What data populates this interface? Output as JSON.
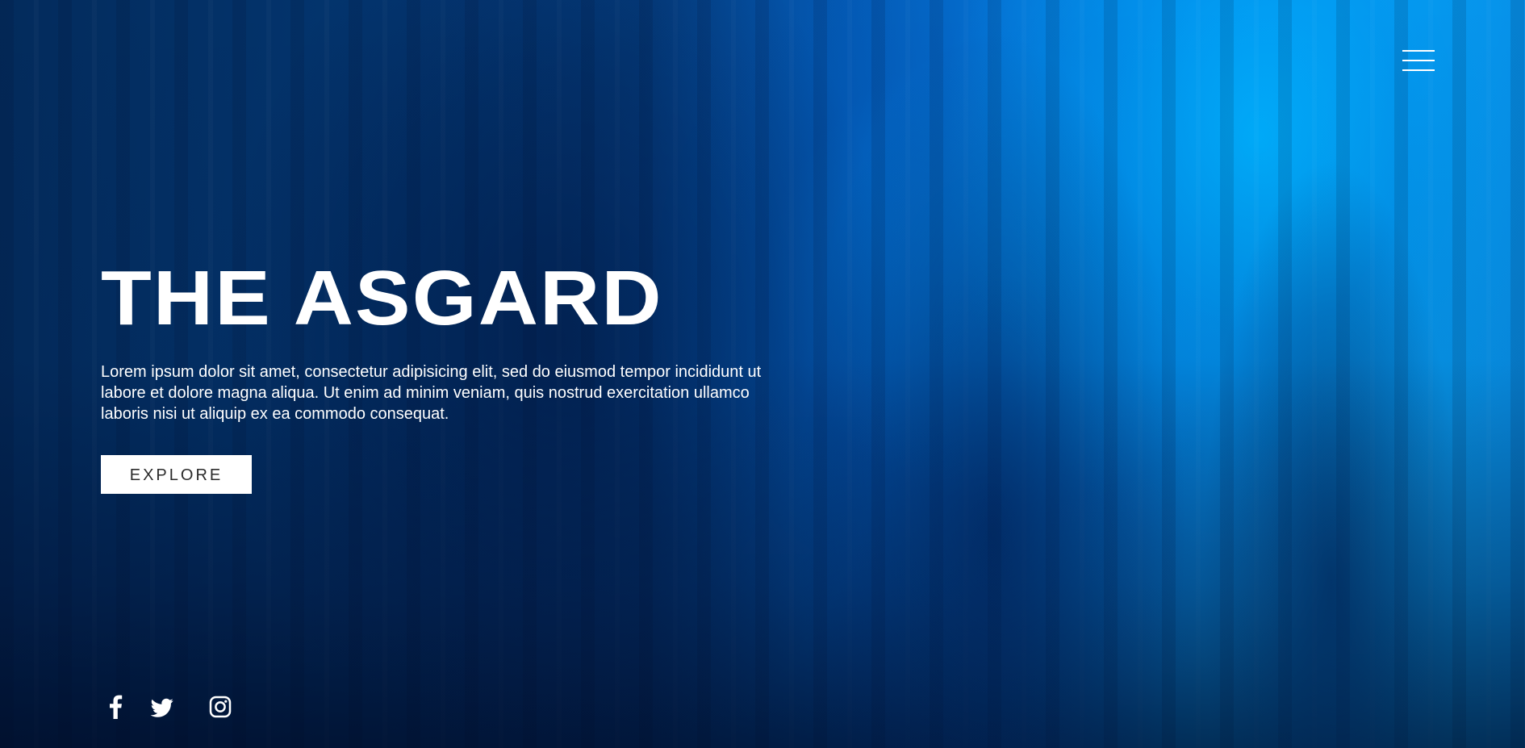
{
  "header": {
    "menu_icon": "hamburger-menu-icon"
  },
  "hero": {
    "title": "THE ASGARD",
    "description": "Lorem ipsum dolor sit amet, consectetur adipisicing elit, sed do eiusmod tempor incididunt ut labore et dolore magna aliqua. Ut enim ad minim veniam, quis nostrud exercitation ullamco laboris nisi ut aliquip ex ea commodo consequat.",
    "button_label": "EXPLORE"
  },
  "social": [
    {
      "network": "Facebook",
      "icon": "facebook-icon"
    },
    {
      "network": "Twitter",
      "icon": "twitter-icon"
    },
    {
      "network": "Instagram",
      "icon": "instagram-icon"
    }
  ],
  "colors": {
    "background_dark": "#03254f",
    "background_light": "#0aa2f0",
    "text": "#ffffff",
    "button_background": "#ffffff",
    "button_text": "#2b2b2b"
  }
}
